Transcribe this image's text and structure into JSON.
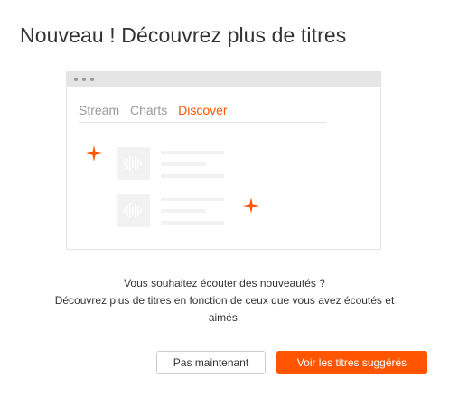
{
  "dialog": {
    "title": "Nouveau ! Découvrez plus de titres"
  },
  "illustration": {
    "tabs": [
      {
        "label": "Stream",
        "active": false
      },
      {
        "label": "Charts",
        "active": false
      },
      {
        "label": "Discover",
        "active": true
      }
    ]
  },
  "message": {
    "line1": "Vous souhaitez écouter des nouveautés ?",
    "line2": "Découvrez plus de titres en fonction de ceux que vous avez écoutés et",
    "line3": "aimés."
  },
  "buttons": {
    "not_now_label": "Pas maintenant",
    "see_suggested_label": "Voir les titres suggérés"
  },
  "colors": {
    "accent": "#ff5500",
    "placeholder": "#f2f2f2",
    "border": "#e5e5e5",
    "text": "#333333",
    "muted_text": "#999999"
  },
  "icons": {
    "sparkle": "sparkle-icon",
    "waveform": "waveform-icon"
  }
}
